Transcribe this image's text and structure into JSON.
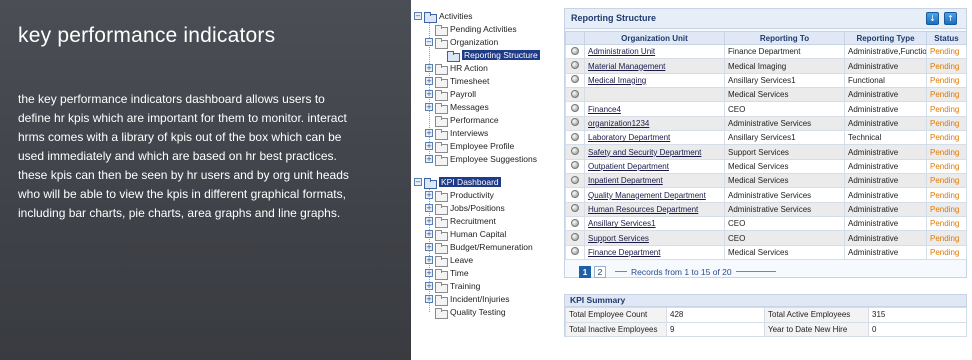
{
  "promo": {
    "title": "key performance indicators",
    "body": "the key performance indicators dashboard allows users to\ndefine hr kpis which are important for them to monitor.  interact\nhrms comes with a library of kpis out of the box which can be\nused immediately and which are based on hr best practices.\nthese kpis can then be seen by hr users and by org unit heads\nwho will be able to view the kpis in different graphical formats,\nincluding bar charts, pie charts, area graphs and line graphs."
  },
  "tree": {
    "activities": "Activities",
    "children": [
      "Pending Activities",
      "Organization",
      "Reporting Structure",
      "HR Action",
      "Timesheet",
      "Payroll",
      "Messages",
      "Performance",
      "Interviews",
      "Employee Profile",
      "Employee Suggestions"
    ],
    "kpi_dashboard": "KPI Dashboard",
    "kpi_children": [
      "Productivity",
      "Jobs/Positions",
      "Recruitment",
      "Human Capital",
      "Budget/Remuneration",
      "Leave",
      "Time",
      "Training",
      "Incident/Injuries",
      "Quality Testing"
    ]
  },
  "reporting": {
    "title": "Reporting Structure",
    "columns": [
      "Organization Unit",
      "Reporting To",
      "Reporting Type",
      "Status"
    ],
    "rows": [
      [
        "Administration Unit",
        "Finance Department",
        "Administrative,Functio",
        "Pending"
      ],
      [
        "Material Management",
        "Medical Imaging",
        "Administrative",
        "Pending"
      ],
      [
        "Medical Imaging",
        "Ansillary Services1",
        "Functional",
        "Pending"
      ],
      [
        "",
        "Medical Services",
        "Administrative",
        "Pending"
      ],
      [
        "Finance4",
        "CEO",
        "Administrative",
        "Pending"
      ],
      [
        "organization1234",
        "Administrative Services",
        "Administrative",
        "Pending"
      ],
      [
        "Laboratory Department",
        "Ansillary Services1",
        "Technical",
        "Pending"
      ],
      [
        "Safety and Security Department",
        "Support Services",
        "Administrative",
        "Pending"
      ],
      [
        "Outpatient Department",
        "Medical Services",
        "Administrative",
        "Pending"
      ],
      [
        "Inpatient Department",
        "Medical Services",
        "Administrative",
        "Pending"
      ],
      [
        "Quality Management Department",
        "Administrative Services",
        "Administrative",
        "Pending"
      ],
      [
        "Human Resources Department",
        "Administrative Services",
        "Administrative",
        "Pending"
      ],
      [
        "Ansillary Services1",
        "CEO",
        "Administrative",
        "Pending"
      ],
      [
        "Support Services",
        "CEO",
        "Administrative",
        "Pending"
      ],
      [
        "Finance Department",
        "Medical Services",
        "Administrative",
        "Pending"
      ]
    ],
    "pages": [
      "1",
      "2"
    ],
    "records": "Records from 1 to 15 of 20"
  },
  "kpi_summary": {
    "title": "KPI Summary",
    "rows": [
      [
        "Total Employee Count",
        "428",
        "Total Active Employees",
        "315"
      ],
      [
        "Total Inactive Employees",
        "9",
        "Year to Date New Hire",
        "0"
      ]
    ]
  },
  "colors": {
    "promo_bg": "#45484e",
    "selected": "#1f3a86",
    "pending": "#e07a00",
    "header": "#dfe8f4"
  }
}
